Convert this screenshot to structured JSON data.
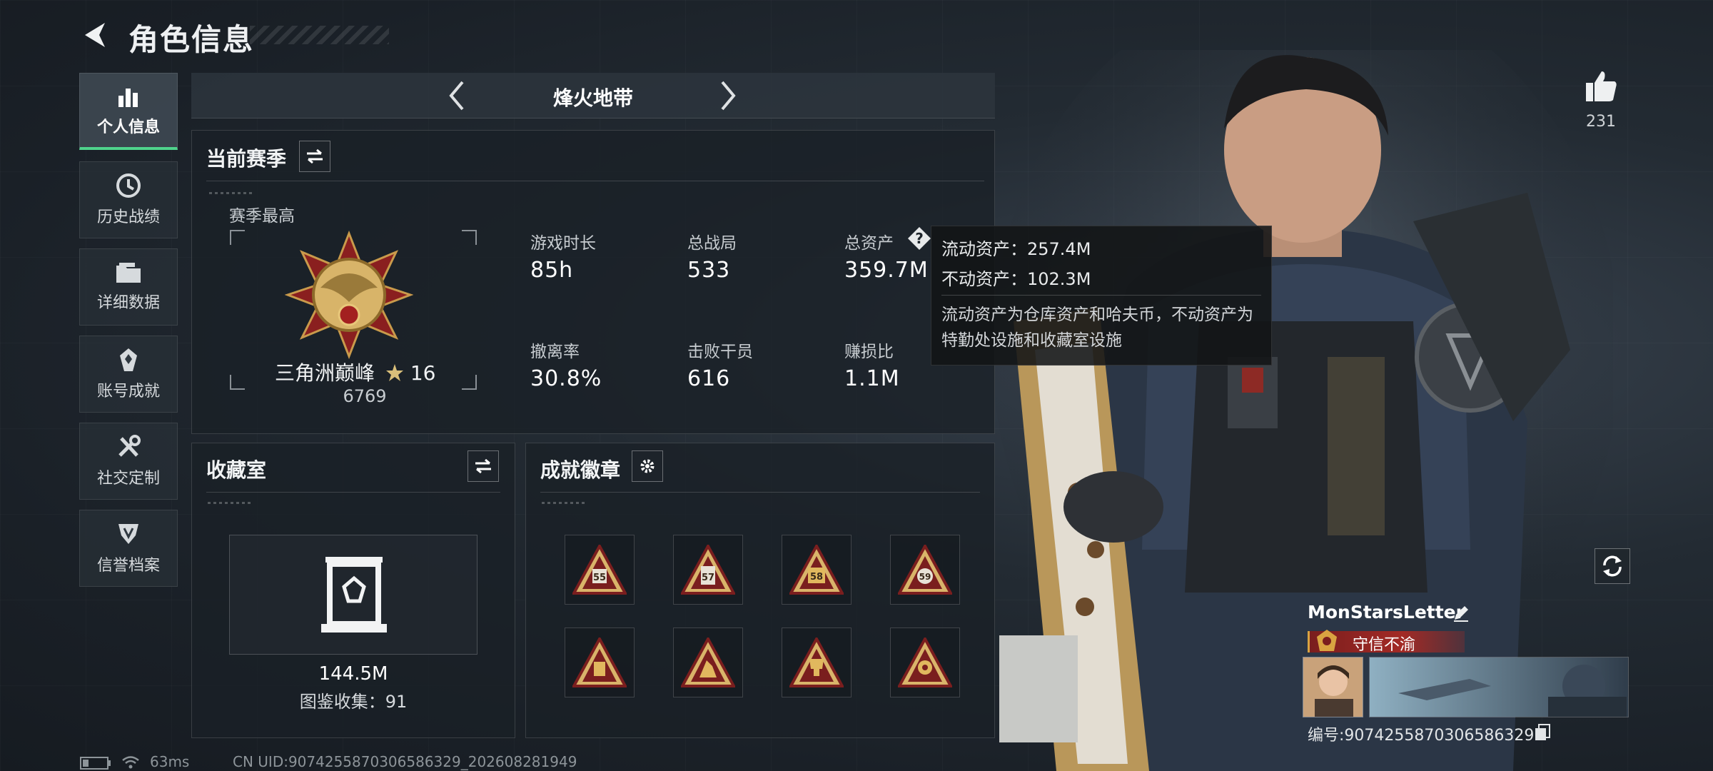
{
  "header": {
    "title": "角色信息"
  },
  "sidebar": {
    "items": [
      {
        "label": "个人信息",
        "icon": "bar-chart-icon",
        "active": true
      },
      {
        "label": "历史战绩",
        "icon": "history-icon"
      },
      {
        "label": "详细数据",
        "icon": "folder-icon"
      },
      {
        "label": "账号成就",
        "icon": "achievement-icon"
      },
      {
        "label": "社交定制",
        "icon": "tools-icon"
      },
      {
        "label": "信誉档案",
        "icon": "shield-icon"
      }
    ]
  },
  "mode": {
    "title": "烽火地带"
  },
  "season": {
    "title": "当前赛季",
    "best_label": "赛季最高",
    "rank_name": "三角洲巅峰",
    "rank_stars": "16",
    "rank_score": "6769",
    "stats": [
      {
        "label": "游戏时长",
        "value": "85h"
      },
      {
        "label": "总战局",
        "value": "533"
      },
      {
        "label": "总资产",
        "value": "359.7M"
      },
      {
        "label": "撤离率",
        "value": "30.8%"
      },
      {
        "label": "击败干员",
        "value": "616"
      },
      {
        "label": "赚损比",
        "value": "1.1M"
      }
    ]
  },
  "tooltip": {
    "liquid": "流动资产：257.4M",
    "fixed": "不动资产：102.3M",
    "desc": "流动资产为仓库资产和哈夫币，不动资产为特勤处设施和收藏室设施"
  },
  "collection": {
    "title": "收藏室",
    "value": "144.5M",
    "count_text": "图鉴收集：91"
  },
  "achievements": {
    "title": "成就徽章",
    "badges": [
      "55",
      "57",
      "58",
      "59",
      "",
      "",
      "",
      ""
    ]
  },
  "likes": {
    "count": "231"
  },
  "player": {
    "name": "MonStarsLetter",
    "title": "守信不渝",
    "id_text": "编号:9074255870306586329"
  },
  "status": {
    "ping": "63ms",
    "uid": "CN UID:9074255870306586329_202608281949"
  },
  "colors": {
    "accent": "#4fd38c",
    "title_red": "#a32a25",
    "gold": "#d9a441"
  }
}
